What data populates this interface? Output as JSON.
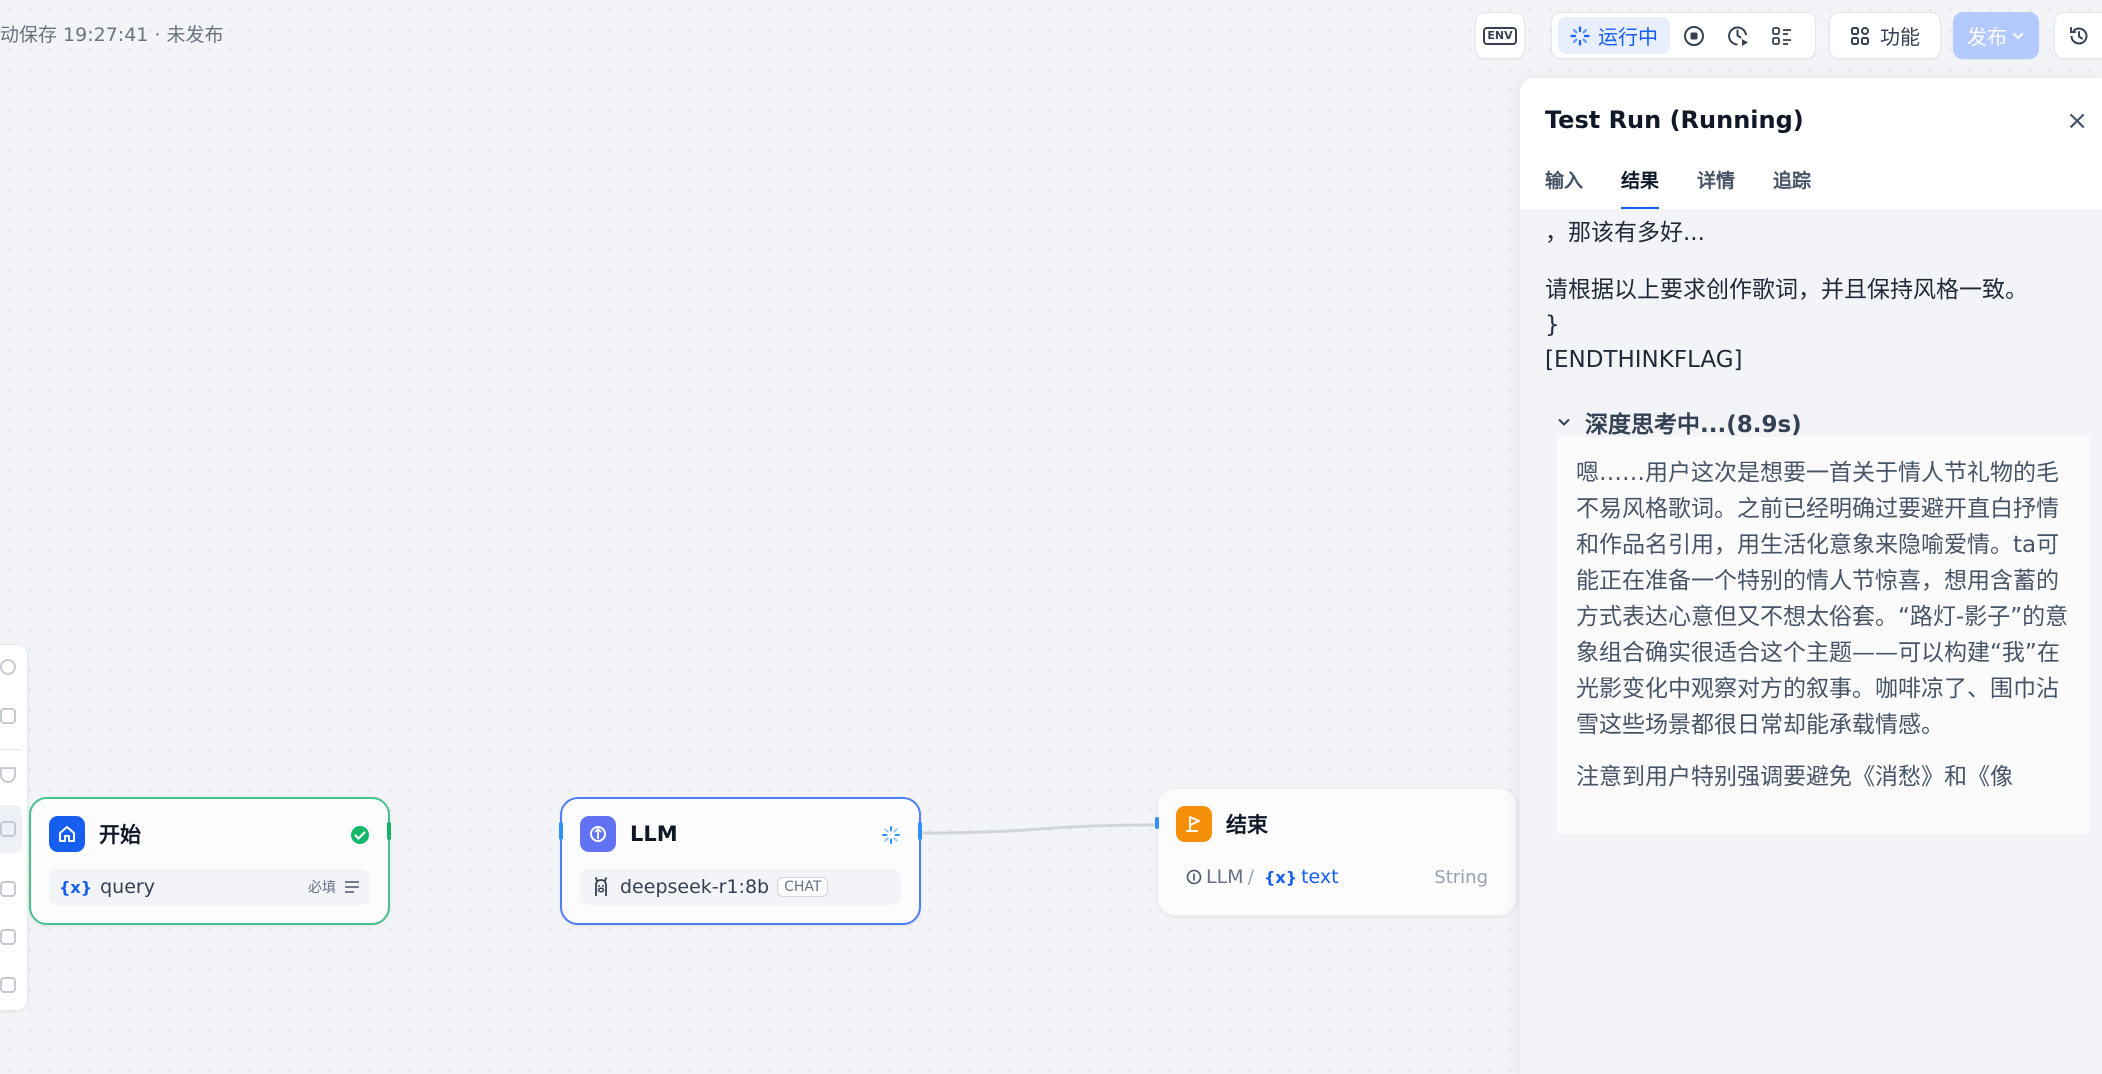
{
  "header": {
    "autosave": "动保存 19:27:41 · 未发布",
    "env_label": "ENV",
    "run_status": "运行中",
    "features": "功能",
    "publish": "发布"
  },
  "nodes": {
    "start": {
      "title": "开始",
      "var_glyph": "{x}",
      "var": "query",
      "required": "必填"
    },
    "llm": {
      "title": "LLM",
      "model": "deepseek-r1:8b",
      "mode": "CHAT"
    },
    "end": {
      "title": "结束",
      "source": "LLM",
      "sep": "/",
      "var_glyph": "{x}",
      "var": "text",
      "type": "String"
    }
  },
  "panel": {
    "title": "Test Run (Running)",
    "close": "×",
    "tabs": [
      "输入",
      "结果",
      "详情",
      "追踪"
    ],
    "result_lines": [
      "，那该有多好...",
      "请根据以上要求创作歌词，并且保持风格一致。",
      "}",
      "[ENDTHINKFLAG]"
    ],
    "think_header": "深度思考中...(8.9s)",
    "think_paragraphs": [
      "嗯……用户这次是想要一首关于情人节礼物的毛不易风格歌词。之前已经明确过要避开直白抒情和作品名引用，用生活化意象来隐喻爱情。ta可能正在准备一个特别的情人节惊喜，想用含蓄的方式表达心意但又不想太俗套。“路灯-影子”的意象组合确实很适合这个主题——可以构建“我”在光影变化中观察对方的叙事。咖啡凉了、围巾沾雪这些场景都很日常却能承载情感。",
      "注意到用户特别强调要避免《消愁》和《像"
    ]
  },
  "colors": {
    "accent": "#155eef",
    "start_border": "#47c18d",
    "llm_border": "#4f7df4",
    "end_icon": "#f79009",
    "success": "#12b76a"
  }
}
